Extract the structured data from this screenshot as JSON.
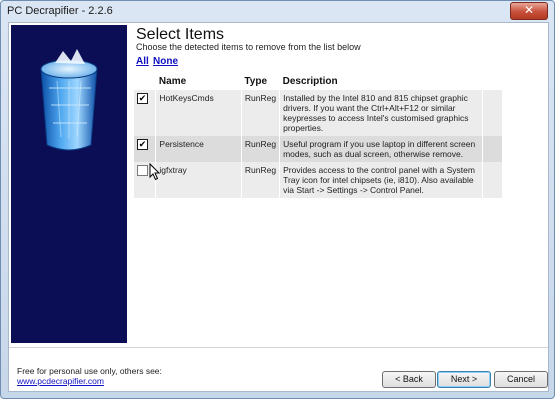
{
  "window": {
    "title": "PC Decrapifier - 2.2.6",
    "close_glyph": "✕"
  },
  "header": {
    "title": "Select Items",
    "subtitle": "Choose the detected items to remove from the list below"
  },
  "selection_links": {
    "all": "All",
    "none": "None"
  },
  "table": {
    "columns": {
      "name": "Name",
      "type": "Type",
      "description": "Description"
    },
    "rows": [
      {
        "checked": "✔",
        "name": "HotKeysCmds",
        "type": "RunReg",
        "description": "Installed by the Intel 810 and 815 chipset graphic drivers. If you want the Ctrl+Alt+F12 or similar keypresses to access Intel's customised graphics properties."
      },
      {
        "checked": "✔",
        "name": "Persistence",
        "type": "RunReg",
        "description": "Useful program if you use laptop in different screen modes, such as dual screen, otherwise remove."
      },
      {
        "checked": "",
        "name": "igfxtray",
        "type": "RunReg",
        "description": "Provides access to the control panel with a System Tray icon for intel chipsets (ie, i810). Also available via Start -> Settings -> Control Panel."
      }
    ]
  },
  "footer": {
    "text": "Free for personal use only, others see:",
    "link": "www.pcdecrapifier.com"
  },
  "buttons": {
    "back": "< Back",
    "next": "Next >",
    "cancel": "Cancel"
  },
  "colors": {
    "side_panel": "#0b0d55",
    "link": "#1010c0",
    "accent": "#3c7fb1"
  },
  "icons": {
    "side_art": "recycle-bin-icon",
    "pointer": "mouse-pointer-icon"
  }
}
